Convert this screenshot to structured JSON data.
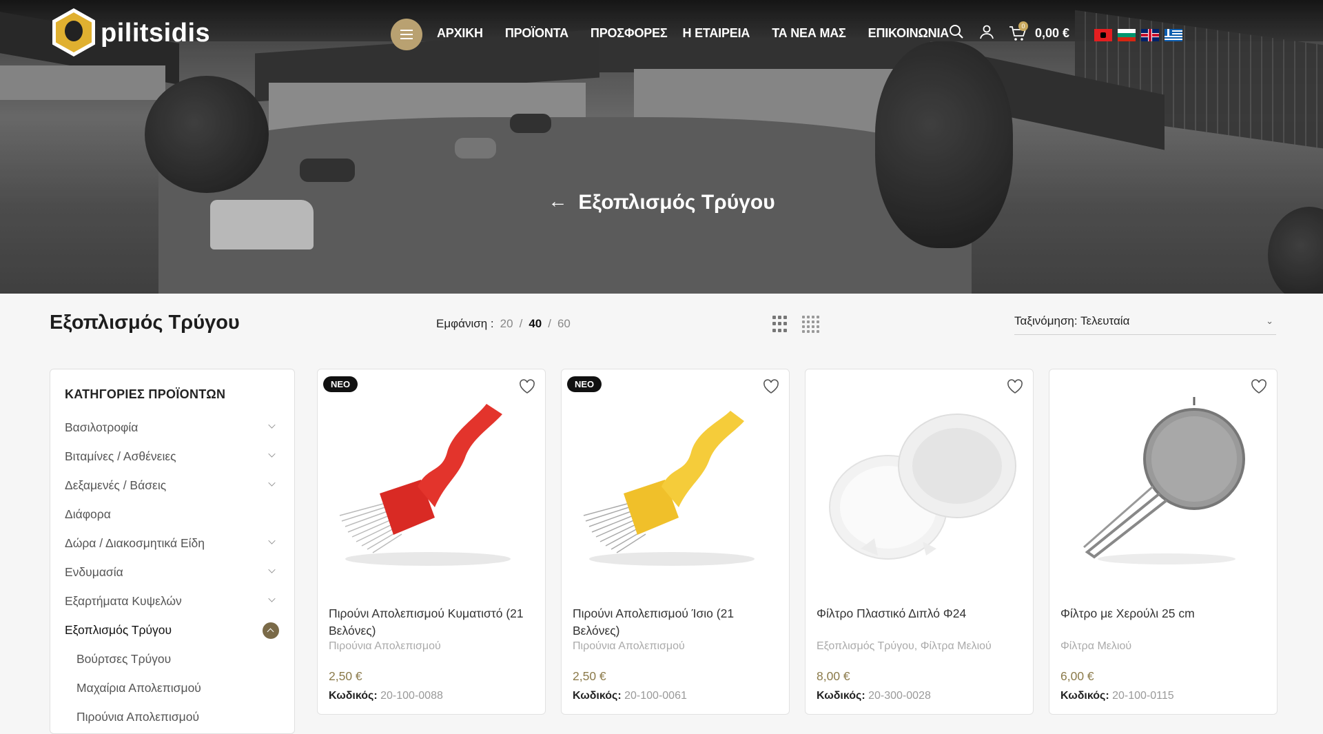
{
  "header": {
    "logo_text": "pilitsidis",
    "nav": [
      "ΑΡΧΙΚΗ",
      "ΠΡΟΪΟΝΤΑ",
      "ΠΡΟΣΦΟΡΕΣ",
      "Η ΕΤΑΙΡΕΙΑ",
      "ΤΑ ΝΕΑ ΜΑΣ",
      "ΕΠΙΚΟΙΝΩΝΙΑ"
    ],
    "cart_count": "0",
    "cart_total": "0,00 €",
    "languages": [
      "Albanian",
      "Bulgarian",
      "English",
      "Greek"
    ]
  },
  "hero": {
    "title": "Εξοπλισμός Τρύγου"
  },
  "toolbar": {
    "page_title": "Εξοπλισμός Τρύγου",
    "show_label": "Εμφάνιση :",
    "per_page": [
      "20",
      "40",
      "60"
    ],
    "per_page_selected": "40",
    "sort_label": "Ταξινόμηση: Τελευταία"
  },
  "sidebar": {
    "title": "ΚΑΤΗΓΟΡΙΕΣ ΠΡΟΪΟΝΤΩΝ",
    "categories": [
      {
        "label": "Βασιλοτροφία",
        "expandable": true
      },
      {
        "label": "Βιταμίνες / Ασθένειες",
        "expandable": true
      },
      {
        "label": "Δεξαμενές / Βάσεις",
        "expandable": true
      },
      {
        "label": "Διάφορα",
        "expandable": false
      },
      {
        "label": "Δώρα / Διακοσμητικά Είδη",
        "expandable": true
      },
      {
        "label": "Ενδυμασία",
        "expandable": true
      },
      {
        "label": "Εξαρτήματα Κυψελών",
        "expandable": true
      },
      {
        "label": "Εξοπλισμός Τρύγου",
        "expandable": true,
        "active": true
      }
    ],
    "subcategories": [
      "Βούρτσες Τρύγου",
      "Μαχαίρια Απολεπισμού",
      "Πιρούνια Απολεπισμού"
    ]
  },
  "products": [
    {
      "badge": "ΝΕΟ",
      "name": "Πιρούνι Απολεπισμού Κυματιστό (21 Βελόνες)",
      "category": "Πιρούνια Απολεπισμού",
      "price": "2,50 €",
      "code_label": "Κωδικός:",
      "code": "20-100-0088",
      "color": "#e0302a"
    },
    {
      "badge": "ΝΕΟ",
      "name": "Πιρούνι Απολεπισμού Ίσιο (21 Βελόνες)",
      "category": "Πιρούνια Απολεπισμού",
      "price": "2,50 €",
      "code_label": "Κωδικός:",
      "code": "20-100-0061",
      "color": "#f2c530"
    },
    {
      "badge": "",
      "name": "Φίλτρο Πλαστικό Διπλό Φ24",
      "category": "Εξοπλισμός Τρύγου, Φίλτρα Μελιού",
      "price": "8,00 €",
      "code_label": "Κωδικός:",
      "code": "20-300-0028",
      "color": "#f0f0f0"
    },
    {
      "badge": "",
      "name": "Φίλτρο με Χερούλι 25 cm",
      "category": "Φίλτρα Μελιού",
      "price": "6,00 €",
      "code_label": "Κωδικός:",
      "code": "20-100-0115",
      "color": "#9a9a9a"
    }
  ]
}
